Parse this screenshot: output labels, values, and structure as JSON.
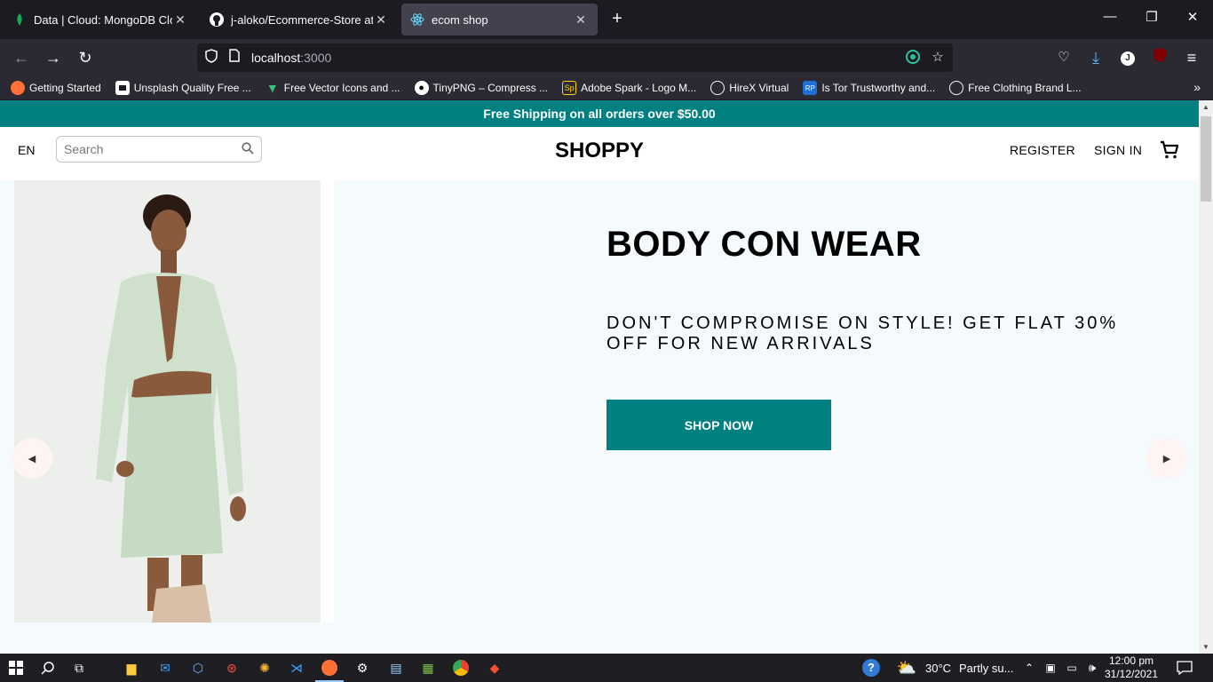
{
  "browser": {
    "tabs": [
      {
        "title": "Data | Cloud: MongoDB Cloud",
        "icon": "mongodb-leaf-icon"
      },
      {
        "title": "j-aloko/Ecommerce-Store at m",
        "icon": "github-icon"
      },
      {
        "title": "ecom shop",
        "icon": "react-icon"
      }
    ],
    "url_host": "localhost",
    "url_port": ":3000",
    "bookmarks": [
      {
        "label": "Getting Started",
        "icon": "firefox-icon"
      },
      {
        "label": "Unsplash Quality Free ...",
        "icon": "unsplash-icon"
      },
      {
        "label": "Free Vector Icons and ...",
        "icon": "vector-icon"
      },
      {
        "label": "TinyPNG – Compress ...",
        "icon": "panda-icon"
      },
      {
        "label": "Adobe Spark - Logo M...",
        "icon": "adobe-spark-icon"
      },
      {
        "label": "HireX Virtual",
        "icon": "globe-icon"
      },
      {
        "label": "Is Tor Trustworthy and...",
        "icon": "rp-icon"
      },
      {
        "label": "Free Clothing Brand L...",
        "icon": "globe-icon"
      }
    ]
  },
  "site": {
    "announcement": "Free Shipping on all orders over $50.00",
    "lang": "EN",
    "search_placeholder": "Search",
    "logo": "SHOPPY",
    "register": "REGISTER",
    "signin": "SIGN IN"
  },
  "slide": {
    "title": "BODY CON WEAR",
    "desc": "DON'T COMPROMISE ON STYLE! GET FLAT 30% OFF FOR NEW ARRIVALS",
    "button": "SHOP NOW"
  },
  "taskbar": {
    "weather_temp": "30°C",
    "weather_text": "Partly su...",
    "time": "12:00 pm",
    "date": "31/12/2021"
  },
  "colors": {
    "teal": "#008080",
    "slide_bg": "#f5fafd"
  }
}
